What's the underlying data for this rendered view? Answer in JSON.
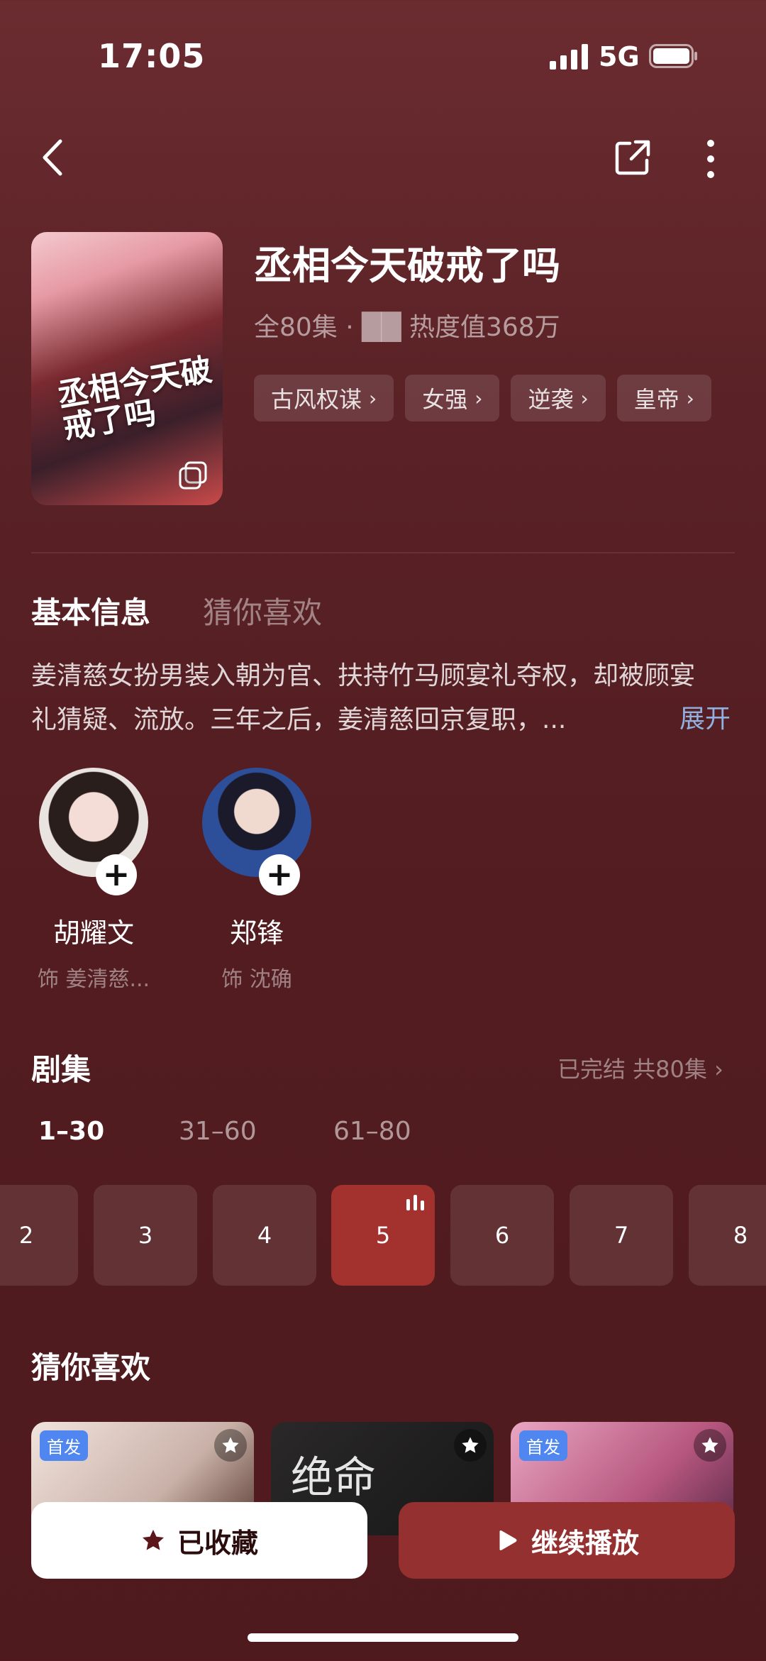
{
  "status_bar": {
    "time": "17:05",
    "network": "5G"
  },
  "drama": {
    "title": "丞相今天破戒了吗",
    "meta": "全80集 · ██ 热度值368万",
    "cover_text": "丞相今天破戒了吗",
    "tags": [
      "古风权谋",
      "女强",
      "逆袭",
      "皇帝"
    ]
  },
  "tabs": {
    "basic": "基本信息",
    "guess": "猜你喜欢"
  },
  "synopsis": "姜清慈女扮男装入朝为官、扶持竹马顾宴礼夺权，却被顾宴礼猜疑、流放。三年之后，姜清慈回京复职，...",
  "expand_label": "展开",
  "cast": [
    {
      "name": "胡耀文",
      "role": "饰 姜清慈..."
    },
    {
      "name": "郑锋",
      "role": "饰 沈确"
    }
  ],
  "episodes": {
    "title": "剧集",
    "status": "已完结 共80集",
    "ranges": [
      "1–30",
      "31–60",
      "61–80"
    ],
    "visible": [
      "2",
      "3",
      "4",
      "5",
      "6",
      "7",
      "8"
    ],
    "current": "5"
  },
  "recommend": {
    "title": "猜你喜欢",
    "first_badge": "首发",
    "card2_text": "绝命"
  },
  "buttons": {
    "saved": "已收藏",
    "play": "继续播放"
  },
  "colors": {
    "accent": "#94302f",
    "active_episode": "#a3322f",
    "link": "#8fb0e0"
  }
}
